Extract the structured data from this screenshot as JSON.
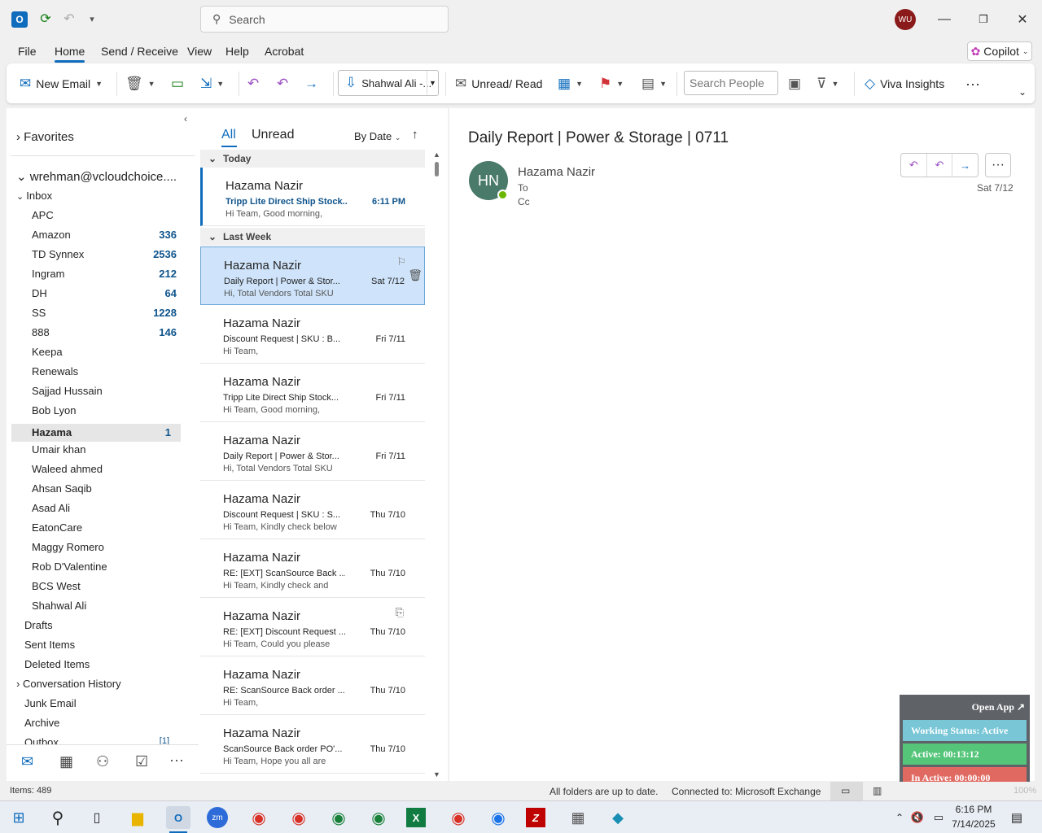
{
  "app": {
    "search_placeholder": "Search",
    "avatar_initials": "WU"
  },
  "menu": {
    "file": "File",
    "home": "Home",
    "send_receive": "Send / Receive",
    "view": "View",
    "help": "Help",
    "acrobat": "Acrobat",
    "copilot": "Copilot"
  },
  "ribbon": {
    "new_email": "New Email",
    "move_to": "Shahwal Ali -...",
    "unread_read": "Unread/ Read",
    "search_people": "Search People",
    "viva": "Viva Insights"
  },
  "nav": {
    "favorites": "Favorites",
    "account": "wrehman@vcloudchoice....",
    "inbox": "Inbox",
    "folders": [
      {
        "name": "APC",
        "count": ""
      },
      {
        "name": "Amazon",
        "count": "336"
      },
      {
        "name": "TD Synnex",
        "count": "2536"
      },
      {
        "name": "Ingram",
        "count": "212"
      },
      {
        "name": "DH",
        "count": "64"
      },
      {
        "name": "SS",
        "count": "1228"
      },
      {
        "name": "888",
        "count": "146"
      },
      {
        "name": "Keepa",
        "count": ""
      },
      {
        "name": "Renewals",
        "count": ""
      },
      {
        "name": "Sajjad Hussain",
        "count": ""
      },
      {
        "name": "Bob Lyon",
        "count": ""
      },
      {
        "name": "Hazama",
        "count": "1"
      },
      {
        "name": "Umair khan",
        "count": ""
      },
      {
        "name": "Waleed ahmed",
        "count": ""
      },
      {
        "name": "Ahsan Saqib",
        "count": ""
      },
      {
        "name": "Asad Ali",
        "count": ""
      },
      {
        "name": "EatonCare",
        "count": ""
      },
      {
        "name": "Maggy Romero",
        "count": ""
      },
      {
        "name": "Rob D'Valentine",
        "count": ""
      },
      {
        "name": "BCS West",
        "count": ""
      },
      {
        "name": "Shahwal Ali",
        "count": ""
      }
    ],
    "drafts": "Drafts",
    "sent": "Sent Items",
    "deleted": "Deleted Items",
    "conv_history": "Conversation History",
    "junk": "Junk Email",
    "archive": "Archive",
    "outbox": "Outbox",
    "outbox_count": "[1]"
  },
  "list": {
    "tab_all": "All",
    "tab_unread": "Unread",
    "sort": "By Date",
    "group_today": "Today",
    "group_last_week": "Last Week",
    "items": [
      {
        "from": "Hazama Nazir",
        "subject": "Tripp Lite Direct Ship Stock...",
        "date": "6:11 PM",
        "preview": "Hi Team,  Good morning,"
      },
      {
        "from": "Hazama Nazir",
        "subject": "Daily Report | Power & Stor...",
        "date": "Sat 7/12",
        "preview": "Hi,  Total Vendors  Total SKU"
      },
      {
        "from": "Hazama Nazir",
        "subject": "Discount Request | SKU : B...",
        "date": "Fri 7/11",
        "preview": "Hi Team,"
      },
      {
        "from": "Hazama Nazir",
        "subject": "Tripp Lite Direct Ship Stock...",
        "date": "Fri 7/11",
        "preview": "Hi Team,  Good morning,"
      },
      {
        "from": "Hazama Nazir",
        "subject": "Daily Report | Power & Stor...",
        "date": "Fri 7/11",
        "preview": "Hi,  Total Vendors  Total SKU"
      },
      {
        "from": "Hazama Nazir",
        "subject": "Discount Request | SKU : S...",
        "date": "Thu 7/10",
        "preview": "Hi Team,  Kindly check below"
      },
      {
        "from": "Hazama Nazir",
        "subject": "RE: [EXT] ScanSource Back ...",
        "date": "Thu 7/10",
        "preview": "Hi Team,  Kindly check and"
      },
      {
        "from": "Hazama Nazir",
        "subject": "RE: [EXT] Discount Request ...",
        "date": "Thu 7/10",
        "preview": "Hi Team,  Could you please"
      },
      {
        "from": "Hazama Nazir",
        "subject": "RE: ScanSource Back order ...",
        "date": "Thu 7/10",
        "preview": "Hi Team,"
      },
      {
        "from": "Hazama Nazir",
        "subject": "ScanSource Back order PO'...",
        "date": "Thu 7/10",
        "preview": "Hi Team,  Hope you all are"
      }
    ]
  },
  "reading": {
    "subject": "Daily Report | Power & Storage | 0711",
    "initials": "HN",
    "sender": "Hazama Nazir",
    "to": "To",
    "cc": "Cc",
    "date": "Sat 7/12"
  },
  "status": {
    "items": "Items: 489",
    "sync": "All folders are up to date.",
    "connected": "Connected to: Microsoft Exchange",
    "zoom": "100%"
  },
  "widget": {
    "open_app": "Open App ↗",
    "working": "Working Status: Active",
    "active": "Active: 00:13:12",
    "inactive": "In Active: 00:00:00"
  },
  "taskbar": {
    "time": "6:16 PM",
    "date": "7/14/2025"
  },
  "colors": {
    "accent": "#0f6cbd",
    "selected": "#cfe4fa"
  }
}
